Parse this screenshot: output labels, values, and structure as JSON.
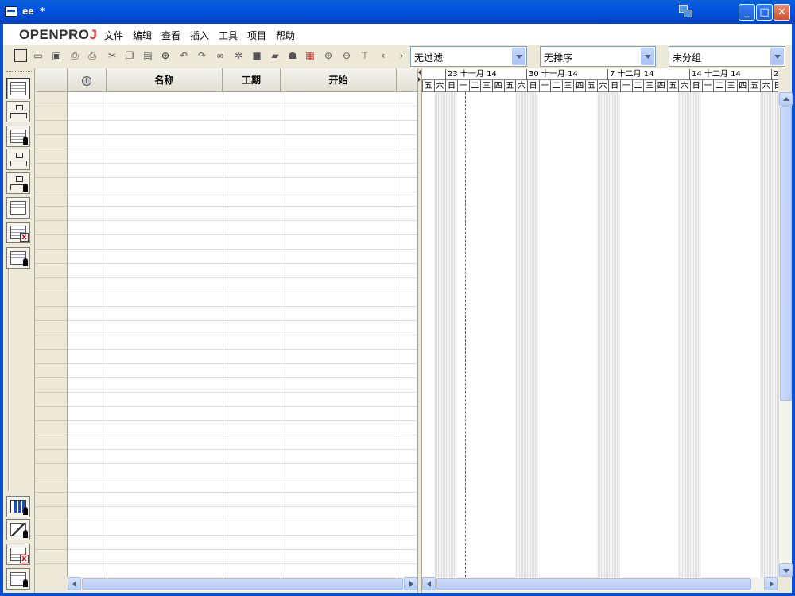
{
  "window": {
    "title": "ee *",
    "controls": {
      "minimize": "_",
      "maximize": "□",
      "close": "✕"
    }
  },
  "logo": {
    "main": "OPENPRO",
    "accent": "J"
  },
  "menu": [
    "文件",
    "编辑",
    "查看",
    "插入",
    "工具",
    "项目",
    "帮助"
  ],
  "toolbar": {
    "filter": "无过滤",
    "sort": "无排序",
    "group": "未分组"
  },
  "grid": {
    "columns": [
      {
        "key": "info",
        "label": ""
      },
      {
        "key": "name",
        "label": "名称"
      },
      {
        "key": "duration",
        "label": "工期"
      },
      {
        "key": "start",
        "label": "开始"
      }
    ]
  },
  "gantt": {
    "weeks": [
      {
        "label": "23 十一月 14"
      },
      {
        "label": "30 十一月 14"
      },
      {
        "label": "7 十二月 14"
      },
      {
        "label": "14 十二月 14"
      },
      {
        "label": "2"
      }
    ],
    "days": [
      "五",
      "六",
      "日",
      "一",
      "二",
      "三",
      "四",
      "五",
      "六",
      "日",
      "一",
      "二",
      "三",
      "四",
      "五",
      "六",
      "日",
      "一",
      "二",
      "三",
      "四",
      "五",
      "六",
      "日",
      "一",
      "二",
      "三",
      "四",
      "五",
      "六",
      "日"
    ]
  },
  "colors": {
    "titlebar": "#0454e0",
    "logo_accent": "#e03a2b",
    "today_line": "#1a8a2a"
  },
  "icons": {
    "view_buttons": [
      "gantt-icon",
      "network-icon",
      "resource-sheet-icon",
      "wbs-icon",
      "rbs-icon",
      "project-list-icon",
      "task-usage-icon",
      "resource-usage-icon",
      "histogram-icon",
      "charts-icon",
      "task-usage-detail-icon",
      "resource-usage-detail-icon"
    ]
  }
}
